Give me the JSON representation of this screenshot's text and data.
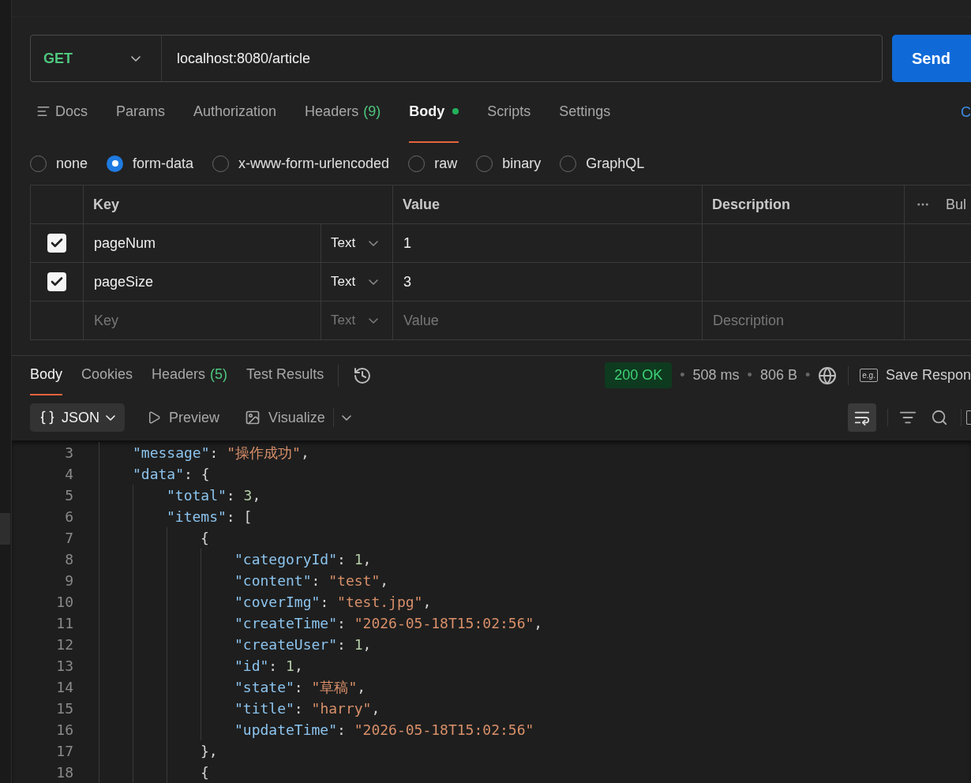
{
  "request": {
    "method": "GET",
    "url": "localhost:8080/article",
    "send": "Send"
  },
  "request_tabs": [
    {
      "label": "Docs",
      "kind": "docs",
      "selected": false
    },
    {
      "label": "Params",
      "selected": false
    },
    {
      "label": "Authorization",
      "selected": false
    },
    {
      "label": "Headers",
      "count": "(9)",
      "selected": false
    },
    {
      "label": "Body",
      "dot": true,
      "selected": true
    },
    {
      "label": "Scripts",
      "selected": false
    },
    {
      "label": "Settings",
      "selected": false
    }
  ],
  "cookies_link": "C",
  "body_modes": [
    {
      "label": "none",
      "selected": false
    },
    {
      "label": "form-data",
      "selected": true
    },
    {
      "label": "x-www-form-urlencoded",
      "selected": false
    },
    {
      "label": "raw",
      "selected": false
    },
    {
      "label": "binary",
      "selected": false
    },
    {
      "label": "GraphQL",
      "selected": false
    }
  ],
  "form_table": {
    "columns": [
      "Key",
      "Value",
      "Description"
    ],
    "bulk": "Bul",
    "rows": [
      {
        "checked": true,
        "key": "pageNum",
        "type": "Text",
        "value": "1"
      },
      {
        "checked": true,
        "key": "pageSize",
        "type": "Text",
        "value": "3"
      }
    ],
    "new_row": {
      "key": {
        "placeholder": "Key"
      },
      "type": "Text",
      "value": {
        "placeholder": "Value"
      },
      "description": {
        "placeholder": "Description"
      }
    }
  },
  "response_tabs": [
    {
      "label": "Body",
      "selected": true
    },
    {
      "label": "Cookies",
      "selected": false
    },
    {
      "label": "Headers",
      "count": "(5)",
      "selected": false
    },
    {
      "label": "Test Results",
      "selected": false
    }
  ],
  "status": {
    "code": "200 OK",
    "time": "508 ms",
    "size": "806 B",
    "separator": "•",
    "example_badge": "e.g.",
    "save": "Save Respon"
  },
  "view_modes": [
    {
      "label": "JSON",
      "kind": "format"
    },
    {
      "label": "Preview",
      "kind": "preview"
    },
    {
      "label": "Visualize",
      "kind": "visualize"
    }
  ],
  "wrap_on": true,
  "code_lines": [
    {
      "number": "3",
      "tokens": [
        {
          "kind": "key",
          "text": "\"message\""
        },
        {
          "kind": "punct",
          "text": ": "
        },
        {
          "kind": "string",
          "text": "\"操作成功\""
        },
        {
          "kind": "punct",
          "text": ","
        }
      ]
    },
    {
      "number": "4",
      "tokens": [
        {
          "kind": "key",
          "text": "\"data\""
        },
        {
          "kind": "punct",
          "text": ": {"
        }
      ],
      "children": [
        {
          "number": "5",
          "tokens": [
            {
              "kind": "key",
              "text": "\"total\""
            },
            {
              "kind": "punct",
              "text": ": "
            },
            {
              "kind": "number",
              "text": "3"
            },
            {
              "kind": "punct",
              "text": ","
            }
          ]
        },
        {
          "number": "6",
          "tokens": [
            {
              "kind": "key",
              "text": "\"items\""
            },
            {
              "kind": "punct",
              "text": ": ["
            }
          ],
          "children": [
            {
              "number": "7",
              "tokens": [
                {
                  "kind": "punct",
                  "text": "{"
                }
              ],
              "children": [
                {
                  "number": "8",
                  "tokens": [
                    {
                      "kind": "key",
                      "text": "\"categoryId\""
                    },
                    {
                      "kind": "punct",
                      "text": ": "
                    },
                    {
                      "kind": "number",
                      "text": "1"
                    },
                    {
                      "kind": "punct",
                      "text": ","
                    }
                  ]
                },
                {
                  "number": "9",
                  "tokens": [
                    {
                      "kind": "key",
                      "text": "\"content\""
                    },
                    {
                      "kind": "punct",
                      "text": ": "
                    },
                    {
                      "kind": "string",
                      "text": "\"test\""
                    },
                    {
                      "kind": "punct",
                      "text": ","
                    }
                  ]
                },
                {
                  "number": "10",
                  "tokens": [
                    {
                      "kind": "key",
                      "text": "\"coverImg\""
                    },
                    {
                      "kind": "punct",
                      "text": ": "
                    },
                    {
                      "kind": "string",
                      "text": "\"test.jpg\""
                    },
                    {
                      "kind": "punct",
                      "text": ","
                    }
                  ]
                },
                {
                  "number": "11",
                  "tokens": [
                    {
                      "kind": "key",
                      "text": "\"createTime\""
                    },
                    {
                      "kind": "punct",
                      "text": ": "
                    },
                    {
                      "kind": "string",
                      "text": "\"2026-05-18T15:02:56\""
                    },
                    {
                      "kind": "punct",
                      "text": ","
                    }
                  ]
                },
                {
                  "number": "12",
                  "tokens": [
                    {
                      "kind": "key",
                      "text": "\"createUser\""
                    },
                    {
                      "kind": "punct",
                      "text": ": "
                    },
                    {
                      "kind": "number",
                      "text": "1"
                    },
                    {
                      "kind": "punct",
                      "text": ","
                    }
                  ]
                },
                {
                  "number": "13",
                  "tokens": [
                    {
                      "kind": "key",
                      "text": "\"id\""
                    },
                    {
                      "kind": "punct",
                      "text": ": "
                    },
                    {
                      "kind": "number",
                      "text": "1"
                    },
                    {
                      "kind": "punct",
                      "text": ","
                    }
                  ]
                },
                {
                  "number": "14",
                  "tokens": [
                    {
                      "kind": "key",
                      "text": "\"state\""
                    },
                    {
                      "kind": "punct",
                      "text": ": "
                    },
                    {
                      "kind": "string",
                      "text": "\"草稿\""
                    },
                    {
                      "kind": "punct",
                      "text": ","
                    }
                  ]
                },
                {
                  "number": "15",
                  "tokens": [
                    {
                      "kind": "key",
                      "text": "\"title\""
                    },
                    {
                      "kind": "punct",
                      "text": ": "
                    },
                    {
                      "kind": "string",
                      "text": "\"harry\""
                    },
                    {
                      "kind": "punct",
                      "text": ","
                    }
                  ]
                },
                {
                  "number": "16",
                  "tokens": [
                    {
                      "kind": "key",
                      "text": "\"updateTime\""
                    },
                    {
                      "kind": "punct",
                      "text": ": "
                    },
                    {
                      "kind": "string",
                      "text": "\"2026-05-18T15:02:56\""
                    }
                  ]
                }
              ]
            },
            {
              "number": "17",
              "tokens": [
                {
                  "kind": "punct",
                  "text": "},"
                }
              ]
            },
            {
              "number": "18",
              "tokens": [
                {
                  "kind": "punct",
                  "text": "{"
                }
              ]
            }
          ]
        }
      ]
    }
  ]
}
